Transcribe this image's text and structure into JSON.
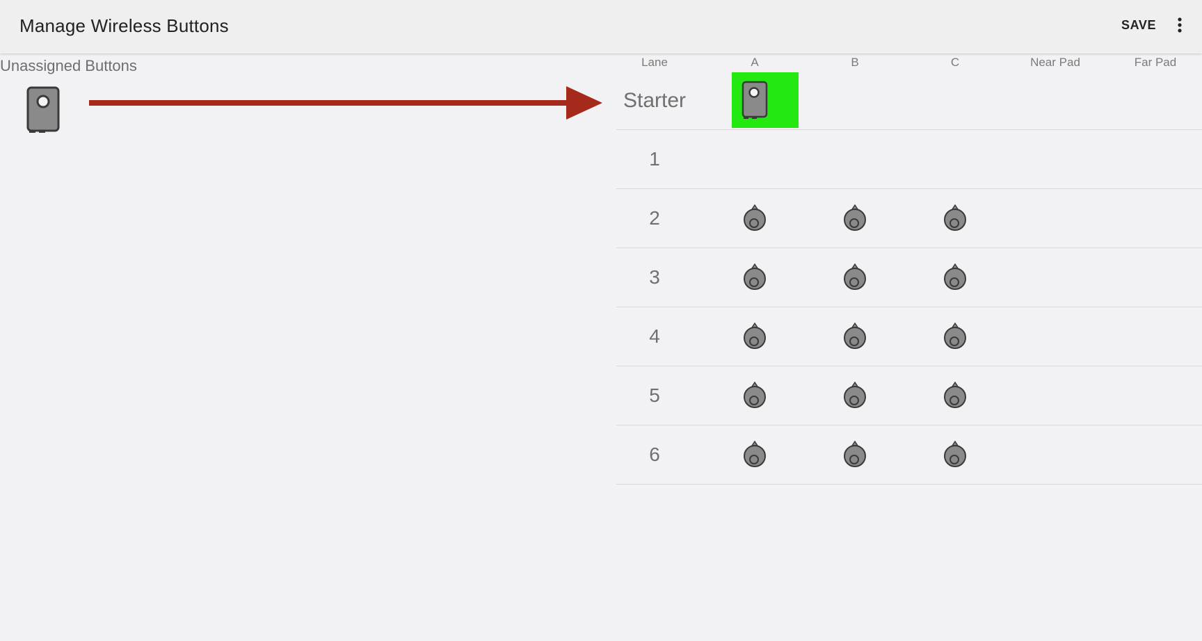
{
  "appbar": {
    "title": "Manage Wireless Buttons",
    "save_label": "SAVE",
    "menu_icon": "more-vert-icon"
  },
  "unassigned": {
    "title": "Unassigned Buttons",
    "devices": [
      {
        "icon": "wireless-button-device-icon"
      }
    ]
  },
  "annotation": {
    "arrow_icon": "arrow-right-icon",
    "arrow_color": "#a52a1c"
  },
  "grid": {
    "columns": [
      "Lane",
      "A",
      "B",
      "C",
      "Near Pad",
      "Far Pad"
    ],
    "starter": {
      "label": "Starter",
      "assigned_column": "A",
      "highlight_color": "#24e811",
      "device_icon": "wireless-button-device-icon"
    },
    "lanes": [
      {
        "label": "1",
        "slots": []
      },
      {
        "label": "2",
        "slots": [
          "A",
          "B",
          "C"
        ]
      },
      {
        "label": "3",
        "slots": [
          "A",
          "B",
          "C"
        ]
      },
      {
        "label": "4",
        "slots": [
          "A",
          "B",
          "C"
        ]
      },
      {
        "label": "5",
        "slots": [
          "A",
          "B",
          "C"
        ]
      },
      {
        "label": "6",
        "slots": [
          "A",
          "B",
          "C"
        ]
      }
    ],
    "slot_icon": "button-puck-icon"
  },
  "colors": {
    "background": "#f2f2f4",
    "appbar": "#efefef",
    "device": "#8a8a8a"
  }
}
